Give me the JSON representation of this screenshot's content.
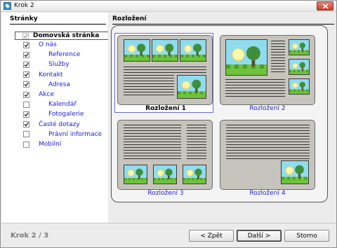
{
  "window": {
    "title": "Krok 2"
  },
  "pages": {
    "heading": "Stránky",
    "items": [
      {
        "label": "Domovská stránka",
        "checked": true,
        "disabled": true,
        "level": 0
      },
      {
        "label": "O nás",
        "checked": true,
        "level": 1
      },
      {
        "label": "Reference",
        "checked": true,
        "level": 2
      },
      {
        "label": "Služby",
        "checked": true,
        "level": 2
      },
      {
        "label": "Kontakt",
        "checked": true,
        "level": 1
      },
      {
        "label": "Adresa",
        "checked": true,
        "level": 2
      },
      {
        "label": "Akce",
        "checked": true,
        "level": 1
      },
      {
        "label": "Kalendář",
        "checked": false,
        "level": 2
      },
      {
        "label": "Fotogalerie",
        "checked": true,
        "level": 2
      },
      {
        "label": "Časté dotazy",
        "checked": true,
        "level": 1
      },
      {
        "label": "Právní informace",
        "checked": false,
        "level": 2
      },
      {
        "label": "Mobilní",
        "checked": false,
        "level": 1
      }
    ]
  },
  "layouts": {
    "heading": "Rozložení",
    "options": [
      {
        "label": "Rozložení 1",
        "selected": true
      },
      {
        "label": "Rozložení 2",
        "selected": false
      },
      {
        "label": "Rozložení 3",
        "selected": false
      },
      {
        "label": "Rozložení 4",
        "selected": false
      }
    ]
  },
  "footer": {
    "step": "Krok 2 / 3",
    "back": "< Zpět",
    "next": "Další >",
    "cancel": "Storno"
  },
  "colors": {
    "link": "#2323d0",
    "sky": "#8fdcef",
    "grass": "#6fc23c",
    "tree": "#3f8f3a"
  }
}
